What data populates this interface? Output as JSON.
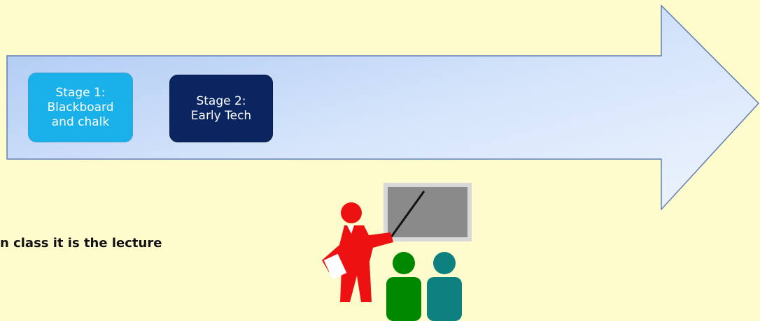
{
  "stages": [
    {
      "label": "Stage 1:\nBlackboard\nand chalk",
      "color": "#1ab0ea"
    },
    {
      "label": "Stage 2:\nEarly Tech",
      "color": "#0b2561"
    }
  ],
  "body_text": "n class it is the lecture",
  "colors": {
    "background": "#fefccc",
    "arrow_fill_light": "#eaf2fd",
    "arrow_fill_dark": "#b4cff3",
    "arrow_stroke": "#5f7fb5",
    "teacher": "#ee1111",
    "student_1": "#008800",
    "student_2": "#0d8080",
    "board": "#8a8a8a"
  },
  "icons": {
    "clipart": "teacher-presenting-icon"
  }
}
